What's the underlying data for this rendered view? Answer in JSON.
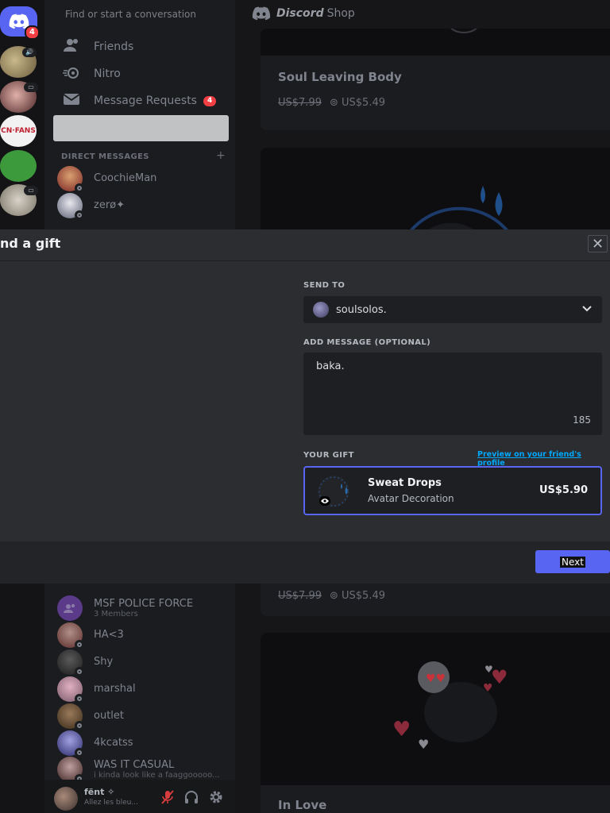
{
  "search": {
    "placeholder": "Find or start a conversation"
  },
  "rail": {
    "home_badge": "4",
    "servers": [
      {
        "name": "server-1",
        "color": "#8a7a5a"
      },
      {
        "name": "server-2",
        "color": "#7a3a3a"
      },
      {
        "name": "cnfans",
        "label": "CN·FANS"
      },
      {
        "name": "server-4",
        "color": "#3e8a3a"
      },
      {
        "name": "server-5",
        "color": "#aaa59a"
      }
    ]
  },
  "nav": {
    "friends": "Friends",
    "nitro": "Nitro",
    "message_requests": "Message Requests",
    "message_requests_badge": "4"
  },
  "dm_header": "DIRECT MESSAGES",
  "dms_top": [
    {
      "name": "CoochieMan"
    },
    {
      "name": "zerø✦"
    }
  ],
  "dms_bottom": [
    {
      "name": "MSF POLICE FORCE",
      "sub": "3 Members"
    },
    {
      "name": "HA<3"
    },
    {
      "name": "Shy"
    },
    {
      "name": "marshal"
    },
    {
      "name": "outlet"
    },
    {
      "name": "4kcatss"
    },
    {
      "name": "WAS IT CASUAL",
      "sub": "i kinda look like a faaggooooo..."
    }
  ],
  "user": {
    "name": "fënt ✧",
    "status": "Allez les bleu..."
  },
  "shop": {
    "brand": "Discord",
    "section": "Shop",
    "cards": [
      {
        "title": "Soul Leaving Body",
        "old_price": "US$7.99",
        "price": "US$5.49"
      },
      {
        "old_price": "US$7.99",
        "price": "US$5.49"
      },
      {
        "title": "In Love"
      }
    ]
  },
  "modal": {
    "title": "nd a gift",
    "send_to_label": "SEND TO",
    "recipient": "soulsolos.",
    "message_label": "ADD MESSAGE (OPTIONAL)",
    "message_value": "baka.",
    "char_count": "185",
    "gift_label": "YOUR GIFT",
    "preview_link": "Preview on your friend's profile",
    "gift_name": "Sweat Drops",
    "gift_type": "Avatar Decoration",
    "gift_price": "US$5.90",
    "next": "Next"
  }
}
